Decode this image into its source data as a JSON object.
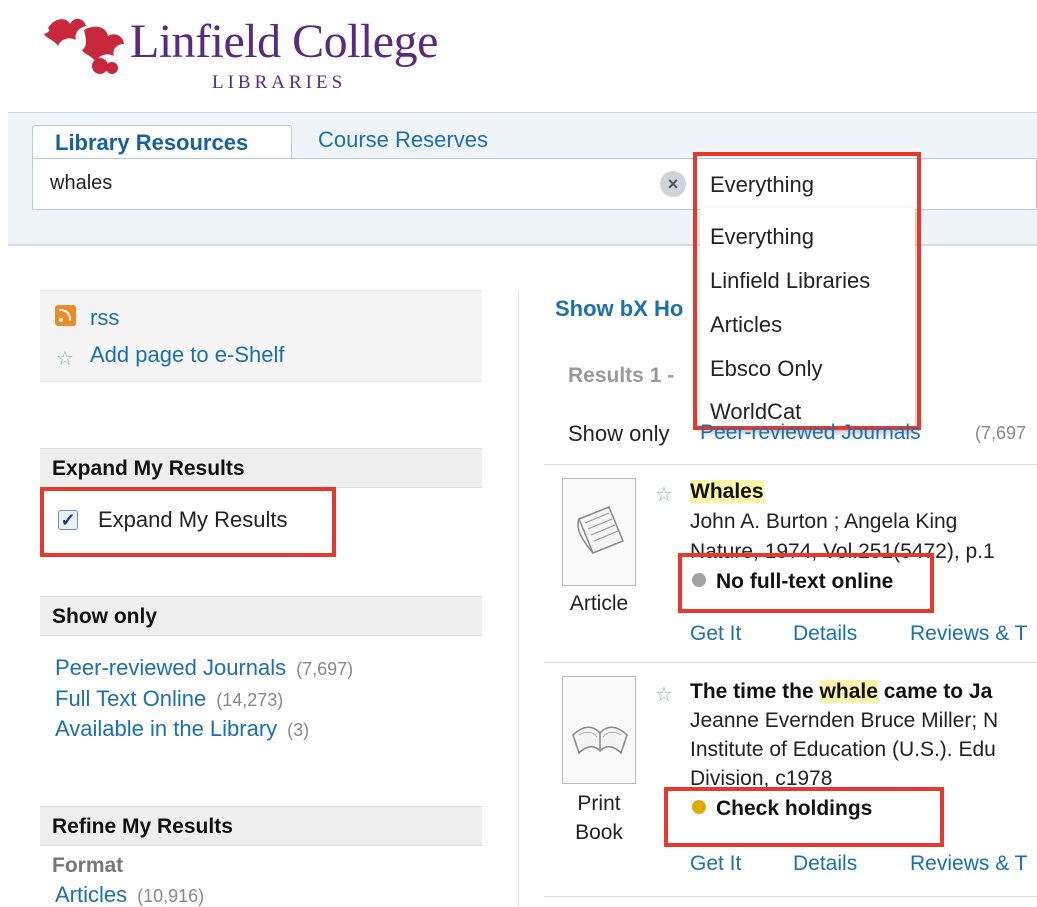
{
  "brand": {
    "name": "Linfield College",
    "sub": "LIBRARIES",
    "logo_icon": "holly-leaf-logo",
    "colors": {
      "primary": "#5a2a82",
      "leaf": "#c8283c",
      "highlight": "#e5392b",
      "link": "#1a6fb3"
    }
  },
  "tabs": [
    {
      "label": "Library Resources",
      "active": true
    },
    {
      "label": "Course Reserves",
      "active": false
    }
  ],
  "search": {
    "query": "whales",
    "clear_icon": "close-icon",
    "scope_selected": "Everything",
    "scope_options": [
      "Everything",
      "Linfield Libraries",
      "Articles",
      "Ebsco Only",
      "WorldCat"
    ]
  },
  "sidebar": {
    "rss_label": "rss",
    "eshelf_label": "Add page to e-Shelf",
    "expand": {
      "heading": "Expand My Results",
      "checkbox_label": "Expand My Results",
      "checked": true
    },
    "show_only": {
      "heading": "Show only",
      "items": [
        {
          "label": "Peer-reviewed Journals",
          "count": "(7,697)"
        },
        {
          "label": "Full Text Online",
          "count": "(14,273)"
        },
        {
          "label": "Available in the Library",
          "count": "(3)"
        }
      ]
    },
    "refine": {
      "heading": "Refine My Results",
      "format_label": "Format",
      "items": [
        {
          "label": "Articles",
          "count": "(10,916)"
        }
      ]
    }
  },
  "results": {
    "bx_link": "Show bX Ho",
    "count_label": "Results 1 -",
    "show_only_label": "Show only",
    "show_only_partial": "Peer-reviewed Journals",
    "show_only_partial_count": "(7,697",
    "items": [
      {
        "type": "Article",
        "title": "Whales",
        "authors": "John A. Burton ; Angela King",
        "source": "Nature, 1974, Vol.251(5472), p.1",
        "status": "No full-text online",
        "status_color": "#a0a0a0",
        "links": [
          "Get It",
          "Details",
          "Reviews & T"
        ]
      },
      {
        "type_line1": "Print",
        "type_line2": "Book",
        "title_before": "The time the ",
        "title_highlight": "whale",
        "title_after": " came to Ja",
        "authors": "Jeanne Evernden Bruce Miller; N",
        "org_line1": "Institute of Education (U.S.). Edu",
        "org_line2": "Division, c1978",
        "status": "Check holdings",
        "status_color": "#e0a800",
        "links": [
          "Get It",
          "Details",
          "Reviews & T"
        ]
      }
    ]
  }
}
